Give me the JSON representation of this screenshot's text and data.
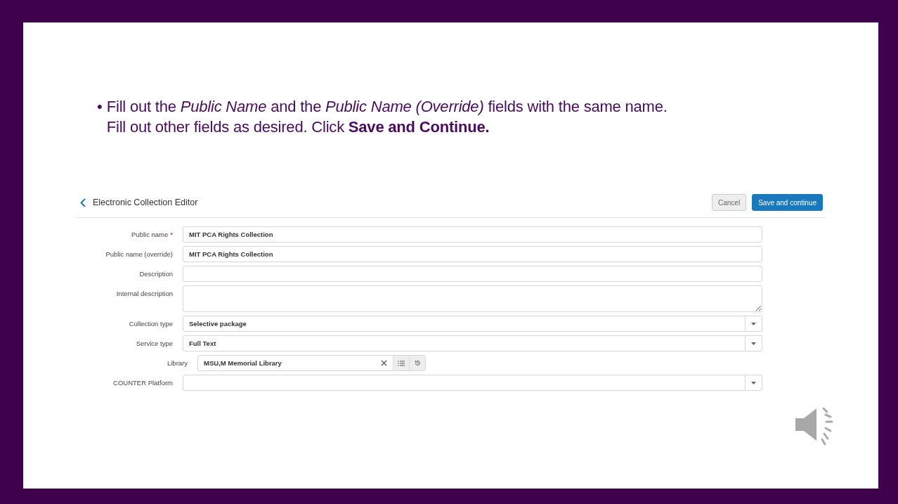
{
  "slide": {
    "bullet": "•",
    "text": "Fill out the *Public Name* and the *Public Name (Override)* fields with the same name. Fill out other fields as desired. Click **Save and Continue.**"
  },
  "editor": {
    "title": "Electronic Collection Editor",
    "buttons": [
      {
        "label": "Cancel",
        "kind": "secondary"
      },
      {
        "label": "Save and continue",
        "kind": "primary"
      }
    ],
    "fields": [
      {
        "kind": "text",
        "label": "Public name",
        "required_mark": "*",
        "value": "MIT PCA Rights Collection"
      },
      {
        "kind": "text",
        "label": "Public name (override)",
        "value": "MIT PCA Rights Collection"
      },
      {
        "kind": "text",
        "label": "Description"
      },
      {
        "kind": "textarea",
        "label": "Internal description"
      },
      {
        "kind": "select",
        "label": "Collection type",
        "value": "Selective package"
      },
      {
        "kind": "select",
        "label": "Service type",
        "value": "Full Text"
      },
      {
        "kind": "lookup",
        "label": "Library",
        "value": "MSU,M Memorial Library"
      },
      {
        "kind": "select",
        "label": "COUNTER Platform"
      }
    ]
  }
}
